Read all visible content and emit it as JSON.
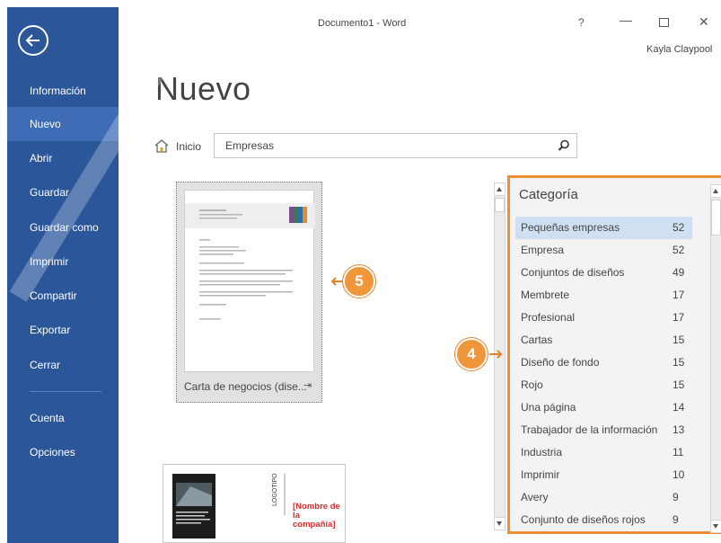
{
  "window": {
    "title": "Documento1 - Word",
    "help": "?",
    "minimize": "—",
    "close": "✕",
    "user": "Kayla Claypool"
  },
  "sidebar": {
    "items": [
      {
        "label": "Información"
      },
      {
        "label": "Nuevo",
        "active": true
      },
      {
        "label": "Abrir"
      },
      {
        "label": "Guardar"
      },
      {
        "label": "Guardar como"
      },
      {
        "label": "Imprimir"
      },
      {
        "label": "Compartir"
      },
      {
        "label": "Exportar"
      },
      {
        "label": "Cerrar"
      },
      {
        "label": "Cuenta"
      },
      {
        "label": "Opciones"
      }
    ]
  },
  "main": {
    "title": "Nuevo",
    "home_label": "Inicio",
    "search_value": "Empresas"
  },
  "templates": [
    {
      "label": "Carta de negocios (dise...",
      "pin_icon": "pin-icon"
    },
    {
      "company_text": "[Nombre de la compañía]",
      "logo_text": "LOGOTIPO"
    }
  ],
  "callouts": {
    "five": "5",
    "four": "4"
  },
  "category": {
    "title": "Categoría",
    "items": [
      {
        "name": "Pequeñas empresas",
        "count": "52",
        "selected": true
      },
      {
        "name": "Empresa",
        "count": "52"
      },
      {
        "name": "Conjuntos de diseños",
        "count": "49"
      },
      {
        "name": "Membrete",
        "count": "17"
      },
      {
        "name": "Profesional",
        "count": "17"
      },
      {
        "name": "Cartas",
        "count": "15"
      },
      {
        "name": "Diseño de fondo",
        "count": "15"
      },
      {
        "name": "Rojo",
        "count": "15"
      },
      {
        "name": "Una página",
        "count": "14"
      },
      {
        "name": "Trabajador de la información",
        "count": "13"
      },
      {
        "name": "Industria",
        "count": "11"
      },
      {
        "name": "Imprimir",
        "count": "10"
      },
      {
        "name": "Avery",
        "count": "9"
      },
      {
        "name": "Conjunto de diseños rojos",
        "count": "9"
      }
    ]
  },
  "colors": {
    "sidebar": "#2b579a",
    "sidebar_active": "#3e6db5",
    "callout": "#f0963a",
    "panel_border": "#ef8f33",
    "selected_row": "#cfe0f3"
  }
}
